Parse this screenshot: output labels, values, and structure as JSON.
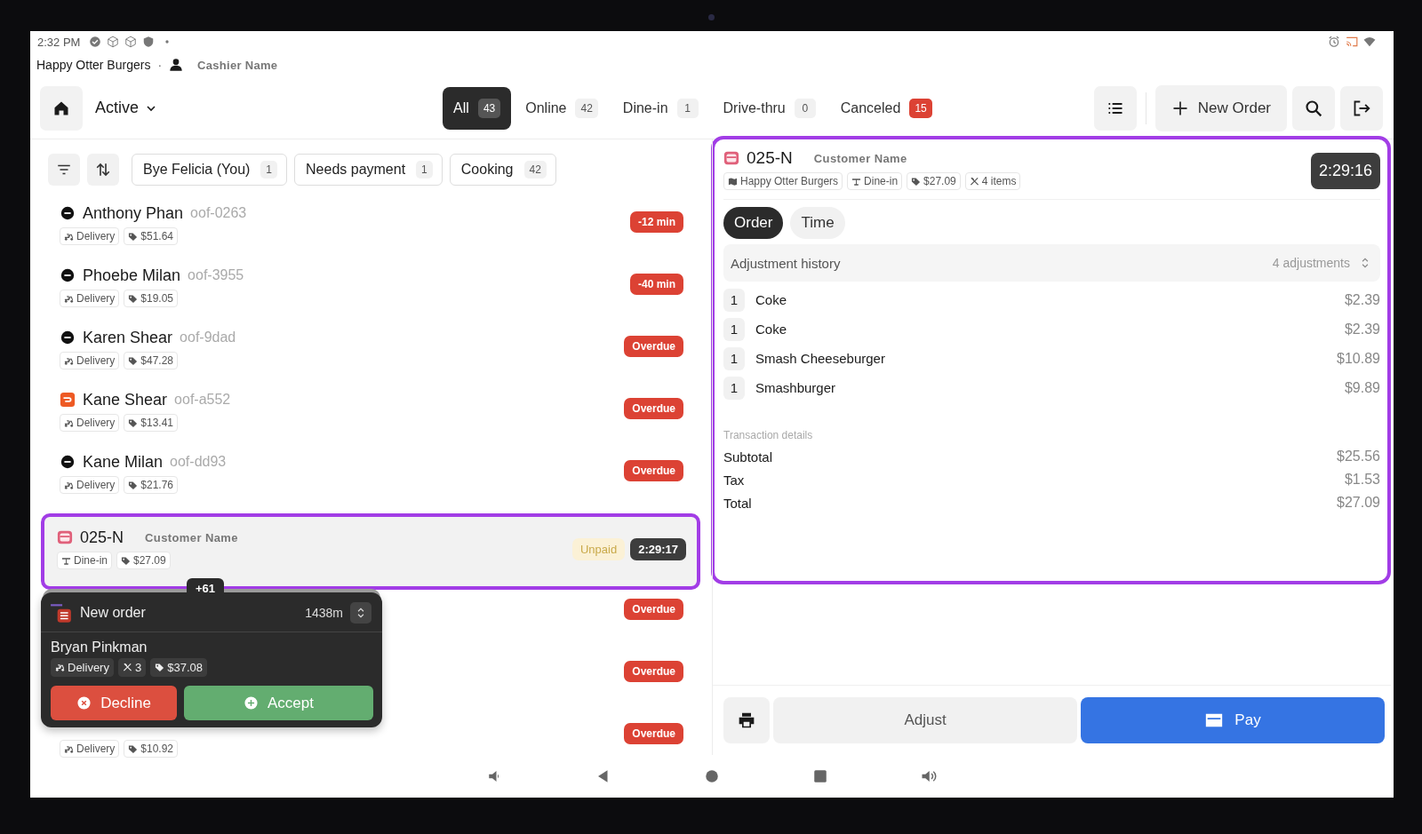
{
  "status_bar": {
    "time": "2:32 PM"
  },
  "header": {
    "store": "Happy Otter Burgers",
    "separator": "·",
    "cashier": "Cashier Name"
  },
  "toolbar": {
    "view_menu": "Active",
    "tabs": [
      {
        "label": "All",
        "count": "43",
        "selected": true,
        "alert": false
      },
      {
        "label": "Online",
        "count": "42",
        "selected": false,
        "alert": false
      },
      {
        "label": "Dine-in",
        "count": "1",
        "selected": false,
        "alert": false
      },
      {
        "label": "Drive-thru",
        "count": "0",
        "selected": false,
        "alert": false
      },
      {
        "label": "Canceled",
        "count": "15",
        "selected": false,
        "alert": true
      }
    ],
    "new_order": "New Order"
  },
  "filters": [
    {
      "label": "Bye Felicia (You)",
      "count": "1"
    },
    {
      "label": "Needs payment",
      "count": "1"
    },
    {
      "label": "Cooking",
      "count": "42"
    }
  ],
  "orders": [
    {
      "kind": "round",
      "name": "Anthony Phan",
      "code": "oof-0263",
      "tags": [
        {
          "kind": "delivery",
          "text": "Delivery"
        },
        {
          "kind": "price",
          "text": "$51.64"
        }
      ],
      "badges": [
        {
          "kind": "alert",
          "text": "-12 min"
        }
      ],
      "selected": false
    },
    {
      "kind": "round",
      "name": "Phoebe Milan",
      "code": "oof-3955",
      "tags": [
        {
          "kind": "delivery",
          "text": "Delivery"
        },
        {
          "kind": "price",
          "text": "$19.05"
        }
      ],
      "badges": [
        {
          "kind": "alert",
          "text": "-40 min"
        }
      ],
      "selected": false
    },
    {
      "kind": "round",
      "name": "Karen Shear",
      "code": "oof-9dad",
      "tags": [
        {
          "kind": "delivery",
          "text": "Delivery"
        },
        {
          "kind": "price",
          "text": "$47.28"
        }
      ],
      "badges": [
        {
          "kind": "alert",
          "text": "Overdue"
        }
      ],
      "selected": false
    },
    {
      "kind": "square",
      "name": "Kane Shear",
      "code": "oof-a552",
      "tags": [
        {
          "kind": "delivery",
          "text": "Delivery"
        },
        {
          "kind": "price",
          "text": "$13.41"
        }
      ],
      "badges": [
        {
          "kind": "alert",
          "text": "Overdue"
        }
      ],
      "selected": false
    },
    {
      "kind": "round",
      "name": "Kane Milan",
      "code": "oof-dd93",
      "tags": [
        {
          "kind": "delivery",
          "text": "Delivery"
        },
        {
          "kind": "price",
          "text": "$21.76"
        }
      ],
      "badges": [
        {
          "kind": "alert",
          "text": "Overdue"
        }
      ],
      "selected": false
    },
    {
      "kind": "card",
      "name": "025-N",
      "customer": "Customer Name",
      "tags": [
        {
          "kind": "dine",
          "text": "Dine-in"
        },
        {
          "kind": "price",
          "text": "$27.09"
        }
      ],
      "badges": [
        {
          "kind": "unpaid",
          "text": "Unpaid"
        },
        {
          "kind": "timer",
          "text": "2:29:17"
        }
      ],
      "selected": true,
      "more": "+61"
    },
    {
      "badges": [
        {
          "kind": "alert",
          "text": "Overdue"
        }
      ],
      "selected": false
    },
    {
      "badges": [
        {
          "kind": "alert",
          "text": "Overdue"
        }
      ],
      "selected": false
    },
    {
      "tags": [
        {
          "kind": "delivery",
          "text": "Delivery"
        },
        {
          "kind": "price",
          "text": "$10.92"
        }
      ],
      "badges": [
        {
          "kind": "alert",
          "text": "Overdue"
        }
      ],
      "selected": false
    }
  ],
  "popup": {
    "title": "New order",
    "age": "1438m",
    "customer": "Bryan Pinkman",
    "tags": [
      {
        "kind": "delivery",
        "text": "Delivery"
      },
      {
        "kind": "items",
        "text": "3"
      },
      {
        "kind": "price",
        "text": "$37.08"
      }
    ],
    "decline": "Decline",
    "accept": "Accept"
  },
  "detail": {
    "highlighted": true,
    "order_id": "025-N",
    "customer": "Customer Name",
    "tags": [
      {
        "kind": "store",
        "text": "Happy Otter Burgers"
      },
      {
        "kind": "dine",
        "text": "Dine-in"
      },
      {
        "kind": "price",
        "text": "$27.09"
      },
      {
        "kind": "items",
        "text": "4 items"
      }
    ],
    "timer": "2:29:16",
    "tabs": [
      {
        "label": "Order",
        "selected": true
      },
      {
        "label": "Time",
        "selected": false
      }
    ],
    "adjustments": {
      "label": "Adjustment history",
      "count": "4 adjustments"
    },
    "items": [
      {
        "qty": "1",
        "name": "Coke",
        "price": "$2.39"
      },
      {
        "qty": "1",
        "name": "Coke",
        "price": "$2.39"
      },
      {
        "qty": "1",
        "name": "Smash Cheeseburger",
        "price": "$10.89"
      },
      {
        "qty": "1",
        "name": "Smashburger",
        "price": "$9.89"
      }
    ],
    "transaction": {
      "heading": "Transaction details",
      "lines": [
        {
          "label": "Subtotal",
          "value": "$25.56"
        },
        {
          "label": "Tax",
          "value": "$1.53"
        },
        {
          "label": "Total",
          "value": "$27.09"
        }
      ]
    },
    "actions": {
      "adjust": "Adjust",
      "pay": "Pay"
    }
  }
}
